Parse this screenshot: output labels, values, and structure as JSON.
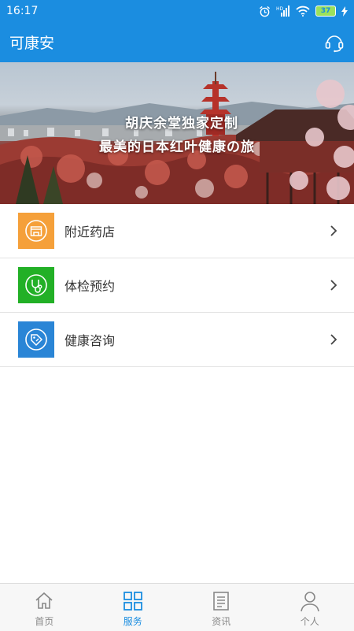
{
  "status_bar": {
    "time": "16:17",
    "battery": "37"
  },
  "app_bar": {
    "title": "可康安"
  },
  "banner": {
    "line1": "胡庆余堂独家定制",
    "line2": "最美的日本红叶健康の旅"
  },
  "menu": {
    "items": [
      {
        "label": "附近药店",
        "icon": "pharmacy-store-icon",
        "color": "#f5a03a"
      },
      {
        "label": "体检预约",
        "icon": "stethoscope-icon",
        "color": "#22b026"
      },
      {
        "label": "健康咨询",
        "icon": "consult-tag-icon",
        "color": "#2a85d6"
      }
    ]
  },
  "bottom_nav": {
    "items": [
      {
        "label": "首页",
        "icon": "home-icon"
      },
      {
        "label": "服务",
        "icon": "grid-icon"
      },
      {
        "label": "资讯",
        "icon": "news-icon"
      },
      {
        "label": "个人",
        "icon": "person-icon"
      }
    ],
    "active_index": 1
  },
  "colors": {
    "primary": "#1b8de0",
    "inactive": "#888888"
  }
}
